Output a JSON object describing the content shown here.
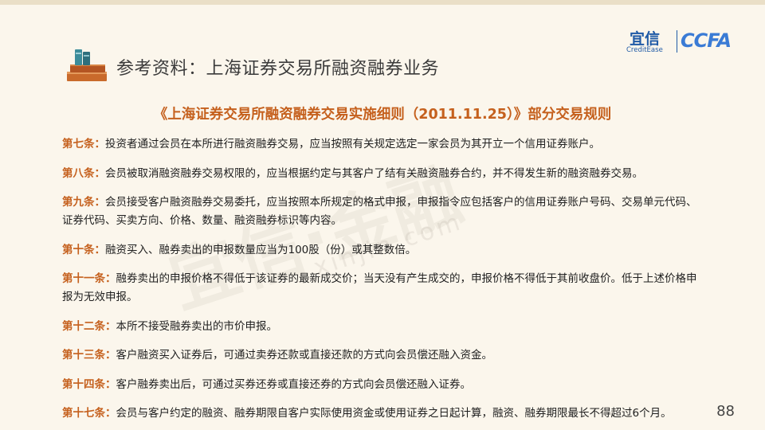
{
  "header": {
    "title": "参考资料：上海证券交易所融资融券业务",
    "logo_cn": "宜信",
    "logo_en": "CreditEase",
    "logo_ccfa": "CCFA"
  },
  "document": {
    "title": "《上海证券交易所融资融券交易实施细则（2011.11.25）》部分交易规则",
    "articles": [
      {
        "label": "第七条：",
        "text": "投资者通过会员在本所进行融资融券交易，应当按照有关规定选定一家会员为其开立一个信用证券账户。"
      },
      {
        "label": "第八条：",
        "text": "会员被取消融资融券交易权限的，应当根据约定与其客户了结有关融资融券合约，并不得发生新的融资融券交易。"
      },
      {
        "label": "第九条：",
        "text": "会员接受客户融资融券交易委托，应当按照本所规定的格式申报，申报指令应包括客户的信用证券账户号码、交易单元代码、证券代码、买卖方向、价格、数量、融资融券标识等内容。"
      },
      {
        "label": "第十条：",
        "text": "融资买入、融券卖出的申报数量应当为100股（份）或其整数倍。"
      },
      {
        "label": "第十一条：",
        "text": "融券卖出的申报价格不得低于该证券的最新成交价；当天没有产生成交的，申报价格不得低于其前收盘价。低于上述价格申报为无效申报。"
      },
      {
        "label": "第十二条：",
        "text": "本所不接受融券卖出的市价申报。"
      },
      {
        "label": "第十三条：",
        "text": "客户融资买入证券后，可通过卖券还款或直接还款的方式向会员偿还融入资金。"
      },
      {
        "label": "第十四条：",
        "text": "客户融券卖出后，可通过买券还券或直接还券的方式向会员偿还融入证券。"
      },
      {
        "label": "第十七条：",
        "text": "会员与客户约定的融资、融券期限自客户实际使用资金或使用证券之日起计算，融资、融券期限最长不得超过6个月。"
      }
    ]
  },
  "watermark": {
    "main": "宜信·金融",
    "sub": "xinjin.com"
  },
  "footer": {
    "page_number": "88"
  },
  "colors": {
    "accent": "#c5601d",
    "brand_blue": "#1f5aa6",
    "background": "#fbf6ec"
  }
}
